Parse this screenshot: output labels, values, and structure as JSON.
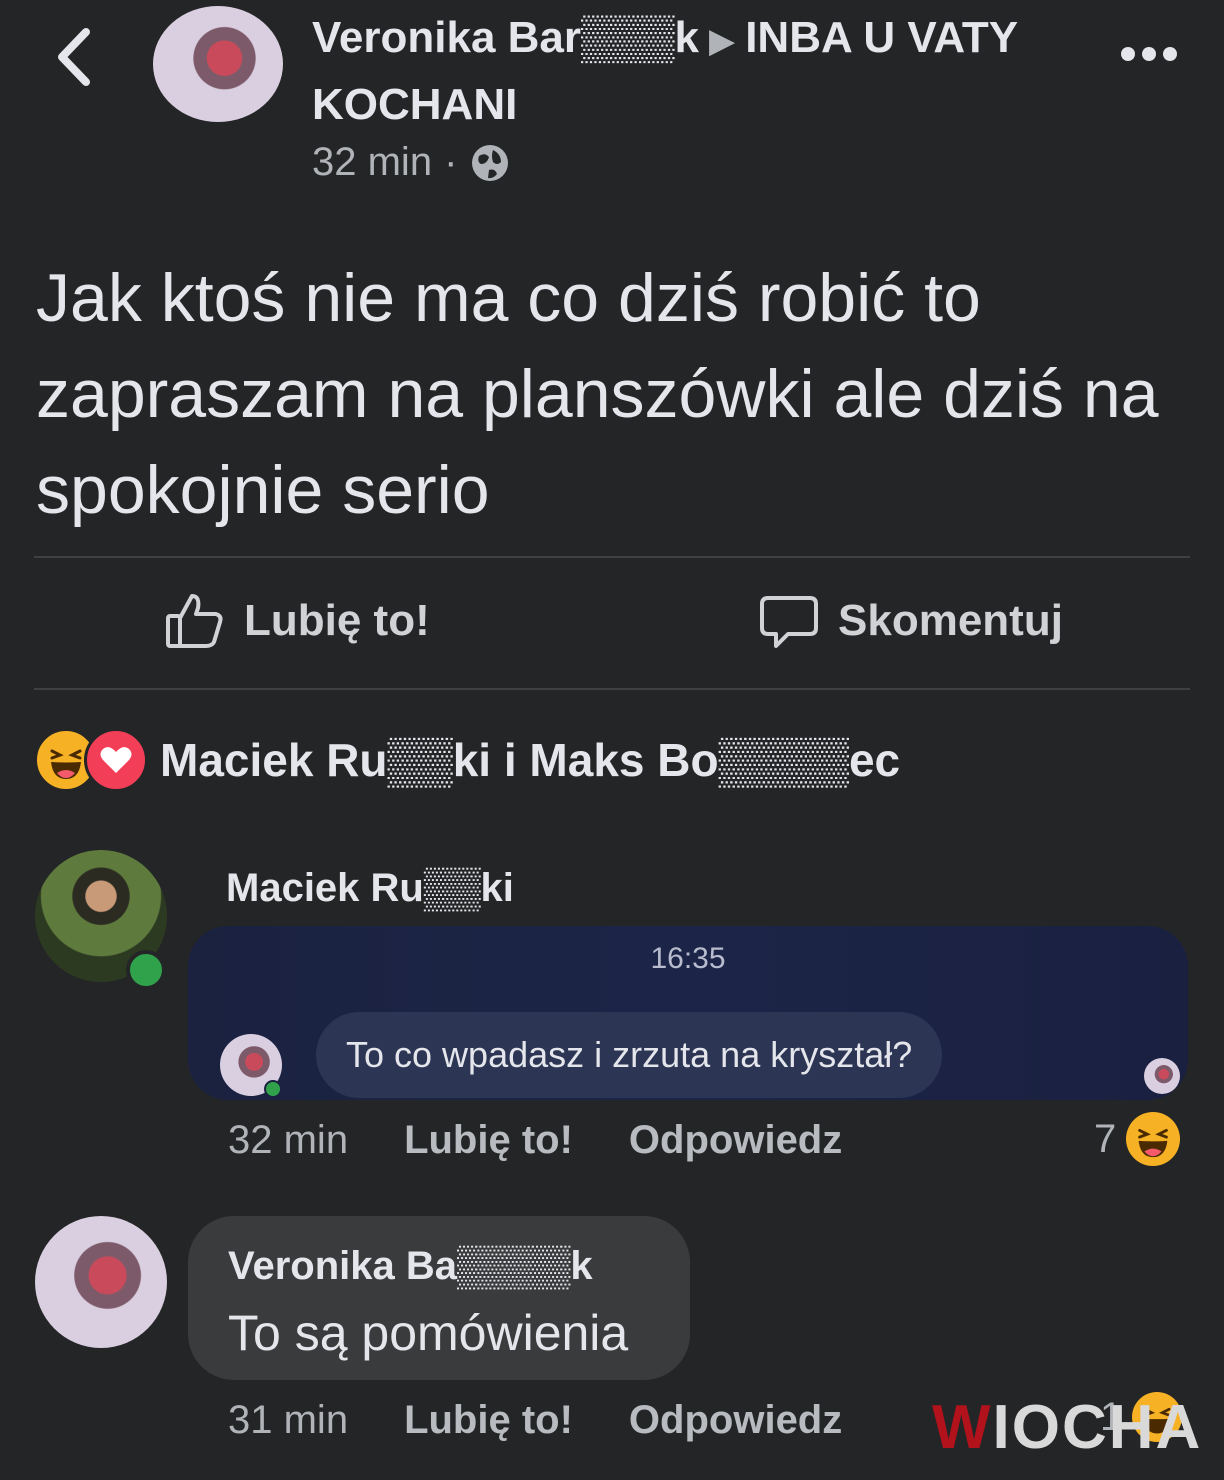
{
  "header": {
    "author": "Veronika Bar▒▒▒k",
    "group": "INBA U VATY KOCHANI",
    "time": "32 min",
    "separator": "·"
  },
  "post": {
    "text": "Jak ktoś nie ma co dziś robić to zapraszam na planszówki ale dziś na spokojnie serio"
  },
  "actions": {
    "like": "Lubię to!",
    "comment": "Skomentuj"
  },
  "reactions": {
    "names": "Maciek Ru▒▒ki i Maks Bo▒▒▒▒ec",
    "icons": [
      "haha-icon",
      "love-icon"
    ]
  },
  "comments": [
    {
      "author": "Maciek Ru▒▒ki",
      "embedded": {
        "time": "16:35",
        "message": "To co wpadasz i zrzuta na kryształ?"
      },
      "time": "32 min",
      "like": "Lubię to!",
      "reply": "Odpowiedz",
      "reaction_count": "7"
    },
    {
      "author": "Veronika Ba▒▒▒▒k",
      "text": "To są pomówienia",
      "time": "31 min",
      "like": "Lubię to!",
      "reply": "Odpowiedz",
      "reaction_count": "1"
    }
  ],
  "watermark": {
    "first": "W",
    "rest": "IOCHA"
  },
  "colors": {
    "background": "#242526",
    "haha": "#f7b125",
    "love": "#f33e58",
    "online": "#31a24c"
  }
}
